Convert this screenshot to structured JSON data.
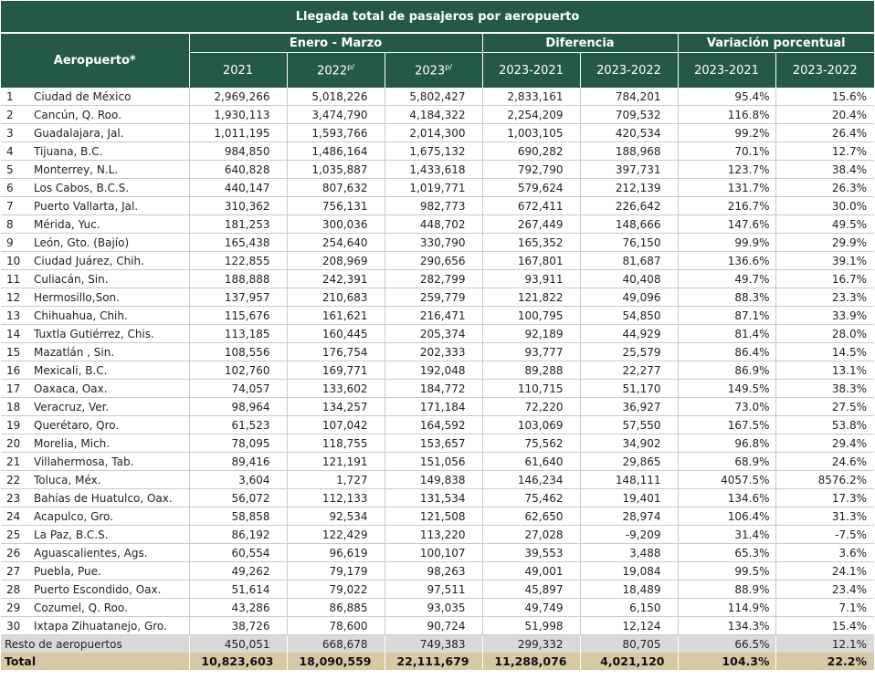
{
  "title": "Llegada total de pasajeros por aeropuerto",
  "headers": {
    "airport": "Aeropuerto*",
    "group1": "Enero - Marzo",
    "group2": "Diferencia",
    "group3": "Variación porcentual",
    "y2021": "2021",
    "y2022": "2022",
    "y2022_sup": "p/",
    "y2023": "2023",
    "y2023_sup": "p/",
    "d1": "2023-2021",
    "d2": "2023-2022",
    "v1": "2023-2021",
    "v2": "2023-2022"
  },
  "rows": [
    [
      "1",
      "Ciudad de México",
      "2,969,266",
      "5,018,226",
      "5,802,427",
      "2,833,161",
      "784,201",
      "95.4%",
      "15.6%"
    ],
    [
      "2",
      "Cancún, Q. Roo.",
      "1,930,113",
      "3,474,790",
      "4,184,322",
      "2,254,209",
      "709,532",
      "116.8%",
      "20.4%"
    ],
    [
      "3",
      "Guadalajara, Jal.",
      "1,011,195",
      "1,593,766",
      "2,014,300",
      "1,003,105",
      "420,534",
      "99.2%",
      "26.4%"
    ],
    [
      "4",
      "Tijuana, B.C.",
      "984,850",
      "1,486,164",
      "1,675,132",
      "690,282",
      "188,968",
      "70.1%",
      "12.7%"
    ],
    [
      "5",
      "Monterrey, N.L.",
      "640,828",
      "1,035,887",
      "1,433,618",
      "792,790",
      "397,731",
      "123.7%",
      "38.4%"
    ],
    [
      "6",
      "Los Cabos, B.C.S.",
      "440,147",
      "807,632",
      "1,019,771",
      "579,624",
      "212,139",
      "131.7%",
      "26.3%"
    ],
    [
      "7",
      "Puerto Vallarta, Jal.",
      "310,362",
      "756,131",
      "982,773",
      "672,411",
      "226,642",
      "216.7%",
      "30.0%"
    ],
    [
      "8",
      "Mérida, Yuc.",
      "181,253",
      "300,036",
      "448,702",
      "267,449",
      "148,666",
      "147.6%",
      "49.5%"
    ],
    [
      "9",
      "León, Gto. (Bajío)",
      "165,438",
      "254,640",
      "330,790",
      "165,352",
      "76,150",
      "99.9%",
      "29.9%"
    ],
    [
      "10",
      "Ciudad Juárez, Chih.",
      "122,855",
      "208,969",
      "290,656",
      "167,801",
      "81,687",
      "136.6%",
      "39.1%"
    ],
    [
      "11",
      "Culiacán, Sin.",
      "188,888",
      "242,391",
      "282,799",
      "93,911",
      "40,408",
      "49.7%",
      "16.7%"
    ],
    [
      "12",
      "Hermosillo,Son.",
      "137,957",
      "210,683",
      "259,779",
      "121,822",
      "49,096",
      "88.3%",
      "23.3%"
    ],
    [
      "13",
      "Chihuahua, Chih.",
      "115,676",
      "161,621",
      "216,471",
      "100,795",
      "54,850",
      "87.1%",
      "33.9%"
    ],
    [
      "14",
      "Tuxtla Gutiérrez, Chis.",
      "113,185",
      "160,445",
      "205,374",
      "92,189",
      "44,929",
      "81.4%",
      "28.0%"
    ],
    [
      "15",
      "Mazatlán , Sin.",
      "108,556",
      "176,754",
      "202,333",
      "93,777",
      "25,579",
      "86.4%",
      "14.5%"
    ],
    [
      "16",
      "Mexicali, B.C.",
      "102,760",
      "169,771",
      "192,048",
      "89,288",
      "22,277",
      "86.9%",
      "13.1%"
    ],
    [
      "17",
      "Oaxaca, Oax.",
      "74,057",
      "133,602",
      "184,772",
      "110,715",
      "51,170",
      "149.5%",
      "38.3%"
    ],
    [
      "18",
      "Veracruz, Ver.",
      "98,964",
      "134,257",
      "171,184",
      "72,220",
      "36,927",
      "73.0%",
      "27.5%"
    ],
    [
      "19",
      "Querétaro, Qro.",
      "61,523",
      "107,042",
      "164,592",
      "103,069",
      "57,550",
      "167.5%",
      "53.8%"
    ],
    [
      "20",
      "Morelia, Mich.",
      "78,095",
      "118,755",
      "153,657",
      "75,562",
      "34,902",
      "96.8%",
      "29.4%"
    ],
    [
      "21",
      "Villahermosa, Tab.",
      "89,416",
      "121,191",
      "151,056",
      "61,640",
      "29,865",
      "68.9%",
      "24.6%"
    ],
    [
      "22",
      "Toluca, Méx.",
      "3,604",
      "1,727",
      "149,838",
      "146,234",
      "148,111",
      "4057.5%",
      "8576.2%"
    ],
    [
      "23",
      "Bahías de Huatulco, Oax.",
      "56,072",
      "112,133",
      "131,534",
      "75,462",
      "19,401",
      "134.6%",
      "17.3%"
    ],
    [
      "24",
      "Acapulco, Gro.",
      "58,858",
      "92,534",
      "121,508",
      "62,650",
      "28,974",
      "106.4%",
      "31.3%"
    ],
    [
      "25",
      "La Paz, B.C.S.",
      "86,192",
      "122,429",
      "113,220",
      "27,028",
      "-9,209",
      "31.4%",
      "-7.5%"
    ],
    [
      "26",
      "Aguascalientes, Ags.",
      "60,554",
      "96,619",
      "100,107",
      "39,553",
      "3,488",
      "65.3%",
      "3.6%"
    ],
    [
      "27",
      "Puebla, Pue.",
      "49,262",
      "79,179",
      "98,263",
      "49,001",
      "19,084",
      "99.5%",
      "24.1%"
    ],
    [
      "28",
      "Puerto Escondido, Oax.",
      "51,614",
      "79,022",
      "97,511",
      "45,897",
      "18,489",
      "88.9%",
      "23.4%"
    ],
    [
      "29",
      "Cozumel, Q. Roo.",
      "43,286",
      "86,885",
      "93,035",
      "49,749",
      "6,150",
      "114.9%",
      "7.1%"
    ],
    [
      "30",
      "Ixtapa Zihuatanejo, Gro.",
      "38,726",
      "78,600",
      "90,724",
      "51,998",
      "12,124",
      "134.3%",
      "15.4%"
    ]
  ],
  "resto": [
    "Resto de aeropuertos",
    "450,051",
    "668,678",
    "749,383",
    "299,332",
    "80,705",
    "66.5%",
    "12.1%"
  ],
  "total": [
    "Total",
    "10,823,603",
    "18,090,559",
    "22,111,679",
    "11,288,076",
    "4,021,120",
    "104.3%",
    "22.2%"
  ]
}
